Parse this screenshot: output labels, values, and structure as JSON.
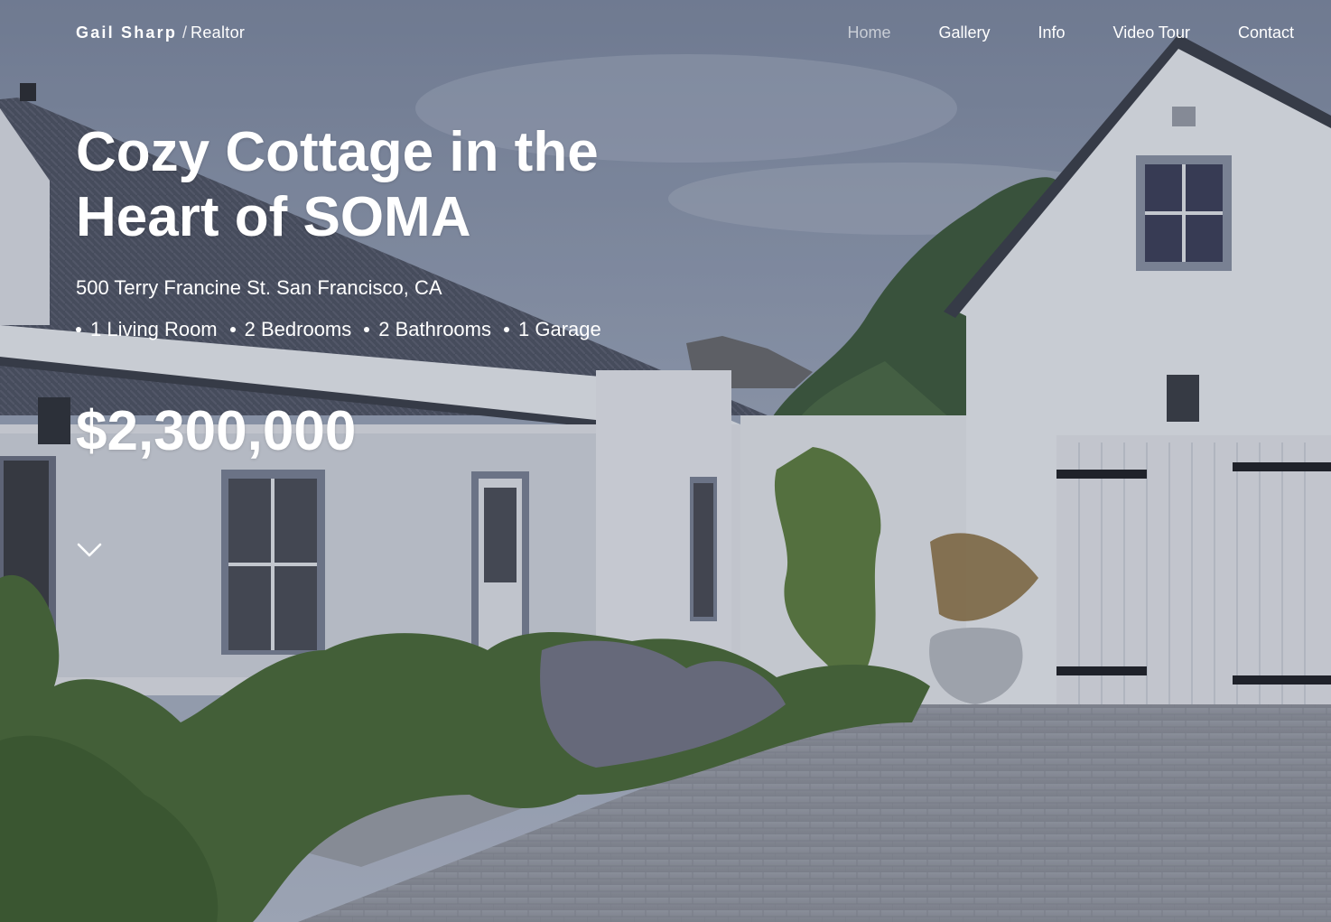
{
  "header": {
    "brand_name": "Gail Sharp",
    "brand_separator": "/",
    "brand_role": "Realtor",
    "nav": [
      {
        "label": "Home",
        "active": true
      },
      {
        "label": "Gallery",
        "active": false
      },
      {
        "label": "Info",
        "active": false
      },
      {
        "label": "Video Tour",
        "active": false
      },
      {
        "label": "Contact",
        "active": false
      }
    ]
  },
  "listing": {
    "title": "Cozy Cottage in the Heart of SOMA",
    "address": "500 Terry Francine St. San Francisco, CA",
    "features": [
      "1 Living Room",
      "2 Bedrooms",
      "2 Bathrooms",
      "1 Garage"
    ],
    "price": "$2,300,000"
  },
  "icons": {
    "scroll": "chevron-down-icon"
  },
  "colors": {
    "text": "#ffffff",
    "nav_active": "#c9ccd3",
    "house_wall": "#e9eaef",
    "roof": "#4c505e",
    "sky": "#8e9ab0"
  }
}
